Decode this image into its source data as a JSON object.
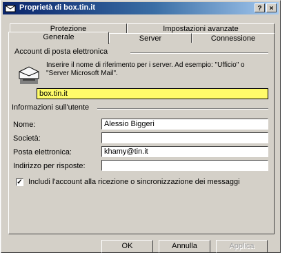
{
  "window": {
    "title": "Proprietà di box.tin.it",
    "help_label": "?",
    "close_label": "×"
  },
  "tabs": {
    "row_back": [
      "Protezione",
      "Impostazioni avanzate"
    ],
    "row_front": [
      "Generale",
      "Server",
      "Connessione"
    ],
    "active": "Generale"
  },
  "account_section": {
    "label": "Account di posta elettronica",
    "description": "Inserire il nome di riferimento per i server. Ad esempio: \"Ufficio\" o \"Server Microsoft Mail\".",
    "account_name": "box.tin.it"
  },
  "user_section": {
    "label": "Informazioni sull'utente",
    "fields": [
      {
        "label": "Nome:",
        "value": "Alessio Biggeri"
      },
      {
        "label": "Società:",
        "value": ""
      },
      {
        "label": "Posta elettronica:",
        "value": "khamy@tin.it"
      },
      {
        "label": "Indirizzo per risposte:",
        "value": ""
      }
    ]
  },
  "include_checkbox": {
    "checked": true,
    "mark": "✓",
    "label": "Includi l'account alla ricezione o sincronizzazione dei messaggi"
  },
  "buttons": {
    "ok": "OK",
    "cancel": "Annulla",
    "apply": "Applica"
  },
  "icons": {
    "title": "envelope-icon",
    "account": "mail-account-icon"
  }
}
